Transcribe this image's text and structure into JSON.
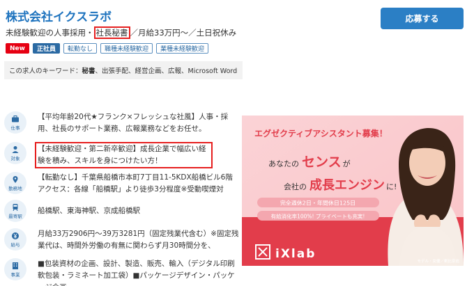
{
  "header": {
    "company": "株式会社イクスラボ",
    "apply_label": "応募する",
    "subtitle_pre": "未経験歓迎の人事採用・",
    "subtitle_hl": "社長秘書",
    "subtitle_post": "／月給33万円〜／土日祝休み"
  },
  "tags": [
    "New",
    "正社員",
    "転勤なし",
    "職種未経験歓迎",
    "業種未経験歓迎"
  ],
  "keywords": {
    "prefix": "この求人のキーワード：",
    "bold": "秘書",
    "rest": "、出張手配、経営企画、広報、Microsoft Word"
  },
  "rows": [
    {
      "icon": "仕事",
      "text": "【平均年齢20代★フランク×フレッシュな社風】人事・採用、社長のサポート業務、広報業務などをお任せ。"
    },
    {
      "icon": "対象",
      "text": "【未経験歓迎・第二新卒歓迎】成長企業で幅広い経験を積み、スキルを身につけたい方！"
    },
    {
      "icon": "勤務地",
      "text": "【転勤なし】千葉県船橋市本町7丁目11-5KDX船橋ビル6階 アクセス：各線「船橋駅」より徒歩3分程度※受動喫煙対"
    },
    {
      "icon": "最寄駅",
      "text": "船橋駅、東海神駅、京成船橋駅"
    },
    {
      "icon": "給与",
      "text": "月給33万2906円〜39万3281円（固定残業代含む）※固定残業代は、時間外労働の有無に関わらず月30時間分を、"
    },
    {
      "icon": "事業",
      "text": "■包装資材の企画、設計、製造、販売、輸入（デジタル印刷軟包装・ラミネート加工袋）■パッケージデザイン・パッケージ企画"
    }
  ],
  "banner": {
    "headline": "エグゼクティブアシスタント募集！",
    "line1_pre": "あなたの",
    "sense": "センス",
    "line1_post": "が",
    "line2_pre": "会社の",
    "growth": "成長エンジン",
    "line2_post": "に!",
    "pill1": "完全週休2日・年間休日125日",
    "pill2": "有給消化率100%! プライベートも充実!",
    "logo_text": "iXlab",
    "credit": "モデル・女優／剣比奈岩"
  }
}
